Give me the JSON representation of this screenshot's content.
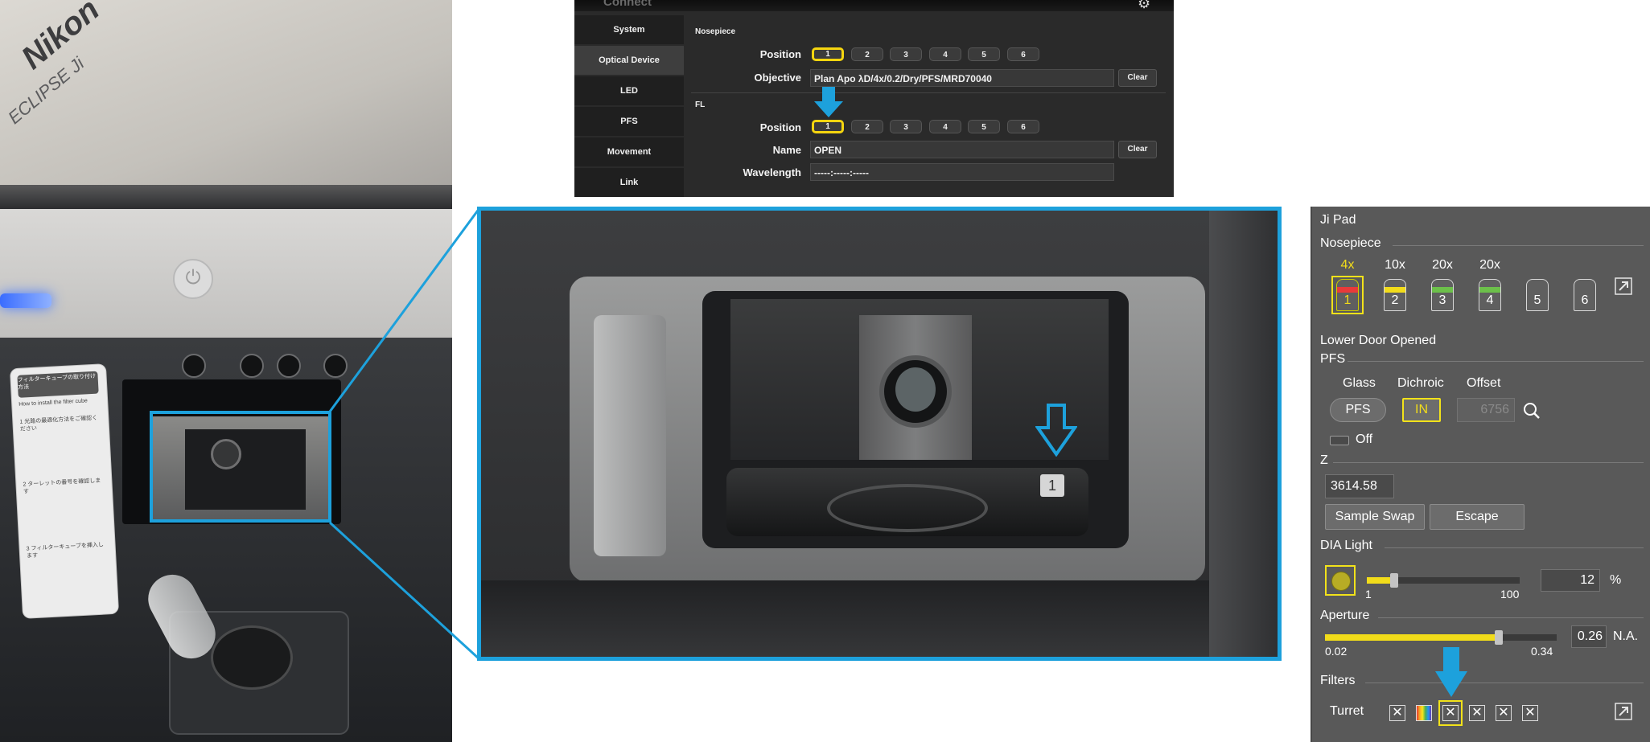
{
  "photo_left": {
    "brand": "Nikon",
    "model": "ECLIPSE Ji",
    "label_title": "フィルターキューブの取り付け方法",
    "label_subtitle": "How to install the filter cube",
    "label_steps": [
      "1 光路の最適化方法をご確認ください",
      "2 ターレットの番号を確認します",
      "3 フィルターキューブを挿入します"
    ]
  },
  "connect_panel": {
    "title": "Connect",
    "nav": [
      "System",
      "Optical Device",
      "LED",
      "PFS",
      "Movement",
      "Link"
    ],
    "active_nav": "Optical Device",
    "nosepiece": {
      "section": "Nosepiece",
      "position_label": "Position",
      "positions": [
        "1",
        "2",
        "3",
        "4",
        "5",
        "6"
      ],
      "selected": "1",
      "objective_label": "Objective",
      "objective_value": "Plan Apo λD/4x/0.2/Dry/PFS/MRD70040",
      "clear": "Clear"
    },
    "fl": {
      "section": "FL",
      "position_label": "Position",
      "positions": [
        "1",
        "2",
        "3",
        "4",
        "5",
        "6"
      ],
      "selected": "1",
      "name_label": "Name",
      "name_value": "OPEN",
      "clear": "Clear",
      "wavelength_label": "Wavelength",
      "wavelength_value": "-----:-----:-----"
    }
  },
  "zoom_photo": {
    "turret_number": "1"
  },
  "ji_pad": {
    "title": "Ji Pad",
    "nosepiece_label": "Nosepiece",
    "objectives": [
      {
        "mag": "4x",
        "num": "1",
        "color": "#e83a3a",
        "selected": true
      },
      {
        "mag": "10x",
        "num": "2",
        "color": "#f2dc1a",
        "selected": false
      },
      {
        "mag": "20x",
        "num": "3",
        "color": "#6cc04a",
        "selected": false
      },
      {
        "mag": "20x",
        "num": "4",
        "color": "#6cc04a",
        "selected": false
      },
      {
        "mag": "",
        "num": "5",
        "color": "",
        "selected": false
      },
      {
        "mag": "",
        "num": "6",
        "color": "",
        "selected": false
      }
    ],
    "lower_door": "Lower Door Opened",
    "pfs_label": "PFS",
    "pfs_glass": "Glass",
    "pfs_dichroic": "Dichroic",
    "pfs_offset": "Offset",
    "pfs_button": "PFS",
    "dichroic_button": "IN",
    "offset_value": "6756",
    "off_label": "Off",
    "z_label": "Z",
    "z_value": "3614.58",
    "sample_swap": "Sample Swap",
    "escape": "Escape",
    "dia_label": "DIA Light",
    "dia_min": "1",
    "dia_max": "100",
    "dia_value": "12",
    "dia_unit": "%",
    "dia_level": 12,
    "aperture_label": "Aperture",
    "aperture_min": "0.02",
    "aperture_max": "0.34",
    "aperture_value": "0.26",
    "aperture_unit": "N.A.",
    "aperture_level": 0.26,
    "filters_label": "Filters",
    "turret_label": "Turret",
    "filters": [
      "x",
      "color",
      "x",
      "x",
      "x",
      "x"
    ],
    "selected_filter": 2
  },
  "colors": {
    "highlight_blue": "#1da1dc",
    "selected_yellow": "#f5d50f"
  }
}
